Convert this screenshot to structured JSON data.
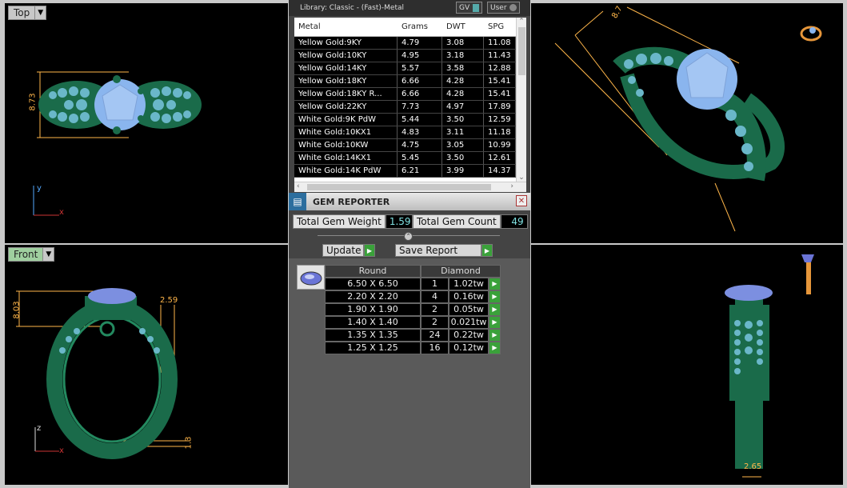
{
  "viewports": {
    "top": {
      "label": "Top",
      "dim_width": "8.73",
      "axis_v": "y",
      "axis_h": "x"
    },
    "front": {
      "label": "Front",
      "dim_height": "8.03",
      "dim_width": "2.59",
      "dim_bottom": "1.3",
      "axis_v": "z",
      "axis_h": "x"
    },
    "perspective": {
      "dim_top": "8.7"
    },
    "side": {
      "dim_bottom": "2.65"
    }
  },
  "library": {
    "title": "Library: Classic - (Fast)-Metal",
    "gv_label": "GV",
    "user_label": "User",
    "columns": [
      "Metal",
      "Grams",
      "DWT",
      "SPG"
    ],
    "rows": [
      [
        "Yellow Gold:9KY",
        "4.79",
        "3.08",
        "11.08"
      ],
      [
        "Yellow Gold:10KY",
        "4.95",
        "3.18",
        "11.43"
      ],
      [
        "Yellow Gold:14KY",
        "5.57",
        "3.58",
        "12.88"
      ],
      [
        "Yellow Gold:18KY",
        "6.66",
        "4.28",
        "15.41"
      ],
      [
        "Yellow Gold:18KY R...",
        "6.66",
        "4.28",
        "15.41"
      ],
      [
        "Yellow Gold:22KY",
        "7.73",
        "4.97",
        "17.89"
      ],
      [
        "White Gold:9K PdW",
        "5.44",
        "3.50",
        "12.59"
      ],
      [
        "White Gold:10KX1",
        "4.83",
        "3.11",
        "11.18"
      ],
      [
        "White Gold:10KW",
        "4.75",
        "3.05",
        "10.99"
      ],
      [
        "White Gold:14KX1",
        "5.45",
        "3.50",
        "12.61"
      ],
      [
        "White Gold:14K PdW",
        "6.21",
        "3.99",
        "14.37"
      ]
    ]
  },
  "gem_reporter": {
    "title": "GEM REPORTER",
    "total_weight_label": "Total Gem Weight",
    "total_weight_value": "1.59",
    "total_count_label": "Total Gem Count",
    "total_count_value": "49",
    "update_label": "Update",
    "save_label": "Save Report",
    "header_shape": "Round",
    "header_type": "Diamond",
    "gems": [
      [
        "6.50 X 6.50",
        "1",
        "1.02tw"
      ],
      [
        "2.20 X 2.20",
        "4",
        "0.16tw"
      ],
      [
        "1.90 X 1.90",
        "2",
        "0.05tw"
      ],
      [
        "1.40 X 1.40",
        "2",
        "0.021tw"
      ],
      [
        "1.35 X 1.35",
        "24",
        "0.22tw"
      ],
      [
        "1.25 X 1.25",
        "16",
        "0.12tw"
      ]
    ]
  }
}
